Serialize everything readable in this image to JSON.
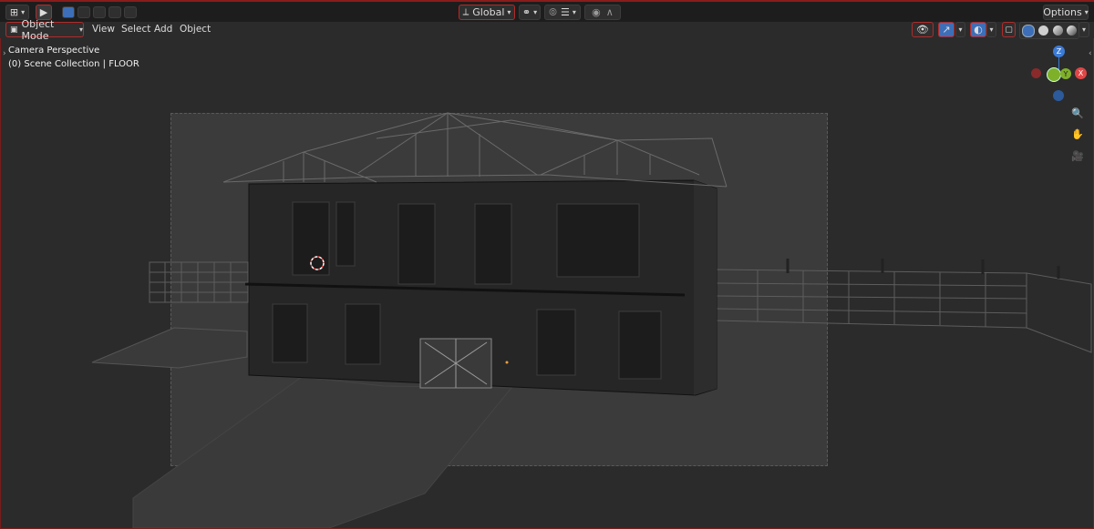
{
  "header": {
    "transform_orientation": "Global",
    "options_label": "Options"
  },
  "viewport_header": {
    "mode_label": "Object Mode",
    "menus": [
      "View",
      "Select",
      "Add",
      "Object"
    ]
  },
  "overlay": {
    "view_name": "Camera Perspective",
    "collection_info": "(0) Scene Collection | FLOOR"
  },
  "gizmo": {
    "axes": [
      "Z",
      "Y",
      "X"
    ],
    "colors": {
      "x": "#e04646",
      "y": "#7fb02a",
      "z": "#3b7bd6",
      "neg": "#8a2a2a"
    }
  },
  "icons": [
    "editor-type-icon",
    "select-tool-icon",
    "select-mode-icons",
    "transform-pivot-icon",
    "snap-icon",
    "proportional-edit-icon",
    "visibility-icon",
    "gizmo-icon",
    "overlay-icon",
    "xray-icon",
    "shading-wireframe-icon",
    "shading-solid-icon",
    "shading-material-icon",
    "shading-rendered-icon",
    "zoom-icon",
    "pan-hand-icon",
    "camera-icon"
  ]
}
